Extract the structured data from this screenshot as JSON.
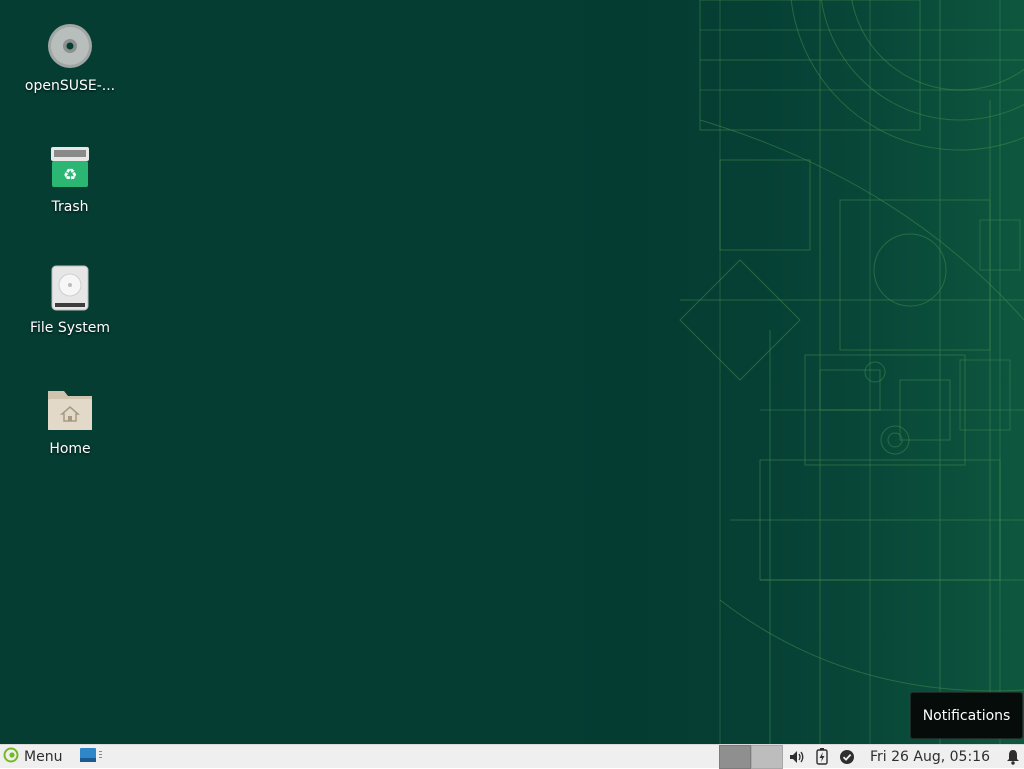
{
  "desktop": {
    "background_color": "#053d33",
    "icons": [
      {
        "label": "openSUSE-...",
        "icon": "optical-disc-icon"
      },
      {
        "label": "Trash",
        "icon": "trash-icon"
      },
      {
        "label": "File System",
        "icon": "hard-drive-icon"
      },
      {
        "label": "Home",
        "icon": "home-folder-icon"
      }
    ]
  },
  "panel": {
    "menu_label": "Menu",
    "menu_icon": "opensuse-logo-icon",
    "taskbar_icon": "application-window-icon",
    "workspaces": [
      "workspace-1",
      "workspace-2"
    ],
    "tray_icons": [
      "volume-icon",
      "battery-icon",
      "updates-check-icon"
    ],
    "clock": "Fri 26 Aug, 05:16",
    "notification_icon": "bell-icon"
  },
  "tooltip": {
    "text": "Notifications"
  }
}
